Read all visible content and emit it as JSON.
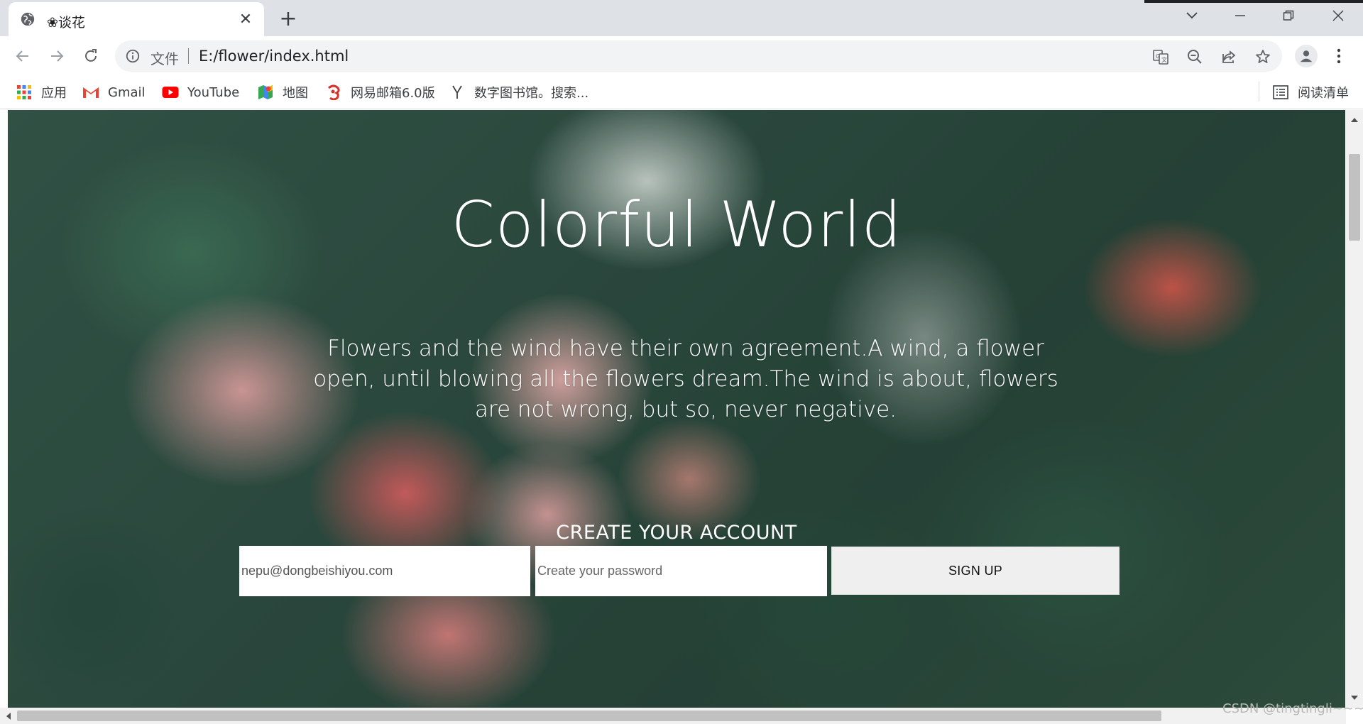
{
  "browser": {
    "tab": {
      "title": "❀谈花",
      "favicon": "globe-icon"
    },
    "address": {
      "file_label": "文件",
      "url": "E:/flower/index.html"
    },
    "bookmarks": [
      {
        "label": "应用",
        "icon": "apps-grid-icon"
      },
      {
        "label": "Gmail",
        "icon": "gmail-icon"
      },
      {
        "label": "YouTube",
        "icon": "youtube-icon"
      },
      {
        "label": "地图",
        "icon": "maps-icon"
      },
      {
        "label": "网易邮箱6.0版",
        "icon": "netease-mail-icon"
      },
      {
        "label": "数字图书馆。搜索...",
        "icon": "library-icon"
      }
    ],
    "reading_list": "阅读清单"
  },
  "page": {
    "title": "Colorful World",
    "text": "Flowers and the wind have their own agreement.A wind, a flower open, until blowing all the flowers dream.The wind is about, flowers are not wrong, but so, never negative.",
    "form": {
      "title": "CREATE YOUR ACCOUNT",
      "email_value": "nepu@dongbeishiyou.com",
      "password_placeholder": "Create your password",
      "button": "SIGN UP"
    }
  },
  "watermark": "CSDN @tingtingli~~~"
}
